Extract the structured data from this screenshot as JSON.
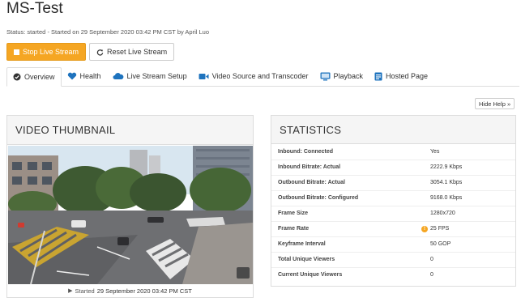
{
  "header": {
    "title": "MS-Test",
    "status": "Status: started - Started on 29 September 2020 03:42 PM CST by April Luo"
  },
  "actions": {
    "stop_label": "Stop Live Stream",
    "reset_label": "Reset Live Stream"
  },
  "tabs": [
    {
      "label": "Overview",
      "icon": "check-circle-icon"
    },
    {
      "label": "Health",
      "icon": "heart-icon"
    },
    {
      "label": "Live Stream Setup",
      "icon": "cloud-icon"
    },
    {
      "label": "Video Source and Transcoder",
      "icon": "video-camera-icon"
    },
    {
      "label": "Playback",
      "icon": "monitor-icon"
    },
    {
      "label": "Hosted Page",
      "icon": "page-icon"
    }
  ],
  "help_label": "Hide Help »",
  "thumbnail": {
    "title": "VIDEO THUMBNAIL",
    "caption_prefix": "Started",
    "caption_date": "29 September 2020 03:42 PM CST"
  },
  "statistics": {
    "title": "STATISTICS",
    "rows": [
      {
        "label": "Inbound: Connected",
        "value": "Yes"
      },
      {
        "label": "Inbound Bitrate: Actual",
        "value": "2222.9 Kbps"
      },
      {
        "label": "Outbound Bitrate: Actual",
        "value": "3054.1 Kbps"
      },
      {
        "label": "Outbound Bitrate: Configured",
        "value": "9168.0 Kbps"
      },
      {
        "label": "Frame Size",
        "value": "1280x720"
      },
      {
        "label": "Frame Rate",
        "value": "25 FPS",
        "warning": true
      },
      {
        "label": "Keyframe Interval",
        "value": "50 GOP"
      },
      {
        "label": "Total Unique Viewers",
        "value": "0"
      },
      {
        "label": "Current Unique Viewers",
        "value": "0"
      }
    ]
  },
  "colors": {
    "accent_orange": "#f5a623",
    "tab_icon_blue": "#1e73be"
  }
}
